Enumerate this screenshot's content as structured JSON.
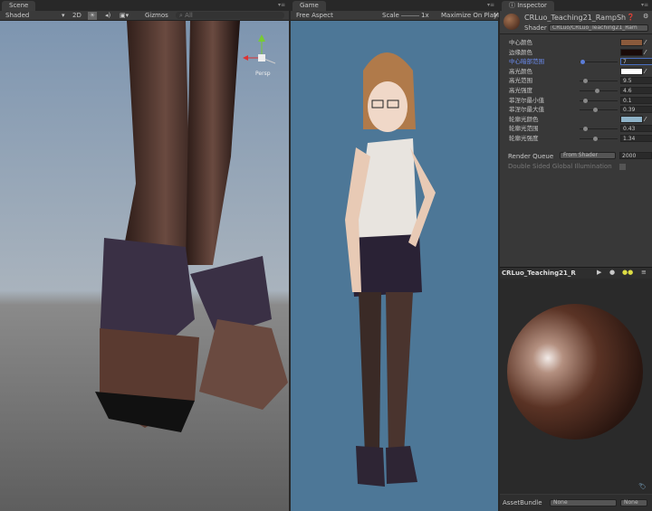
{
  "scene": {
    "tab": "Scene",
    "shading": "Shaded",
    "mode_2d": "2D",
    "gizmos": "Gizmos",
    "search_placeholder": "All",
    "persp": "Persp"
  },
  "game": {
    "tab": "Game",
    "aspect": "Free Aspect",
    "scale_label": "Scale",
    "scale_value": "1x",
    "maximize": "Maximize On Play",
    "more": "M"
  },
  "inspector": {
    "tab": "Inspector",
    "material_name": "CRLuo_Teaching21_RampSh",
    "shader_label": "Shader",
    "shader_value": "CRLuo/CRLuo_Teaching21_Ram",
    "properties": [
      {
        "label": "中心颜色",
        "type": "color",
        "color": "#8a5a3c"
      },
      {
        "label": "边缘颜色",
        "type": "color",
        "color": "#1a0a08"
      },
      {
        "label": "中心暗部范围",
        "type": "slider",
        "value": "7",
        "fraction": 0.02,
        "active": true
      },
      {
        "label": "高光颜色",
        "type": "color",
        "color": "#ffffff"
      },
      {
        "label": "高光范围",
        "type": "slider",
        "value": "9.5",
        "fraction": 0.1
      },
      {
        "label": "高光强度",
        "type": "slider",
        "value": "4.6",
        "fraction": 0.45
      },
      {
        "label": "菲涅尔最小值",
        "type": "slider",
        "value": "0.1",
        "fraction": 0.1
      },
      {
        "label": "菲涅尔最大值",
        "type": "slider",
        "value": "0.39",
        "fraction": 0.39
      },
      {
        "label": "轮廓光颜色",
        "type": "color",
        "color": "#8fb3c8"
      },
      {
        "label": "轮廓光范围",
        "type": "slider",
        "value": "0.43",
        "fraction": 0.1
      },
      {
        "label": "轮廓光强度",
        "type": "slider",
        "value": "1.34",
        "fraction": 0.4
      }
    ],
    "render_queue_label": "Render Queue",
    "render_queue_mode": "From Shader",
    "render_queue_value": "2000",
    "gi_label": "Double Sided Global Illumination",
    "preview_title": "CRLuo_Teaching21_R",
    "assetbundle_label": "AssetBundle",
    "assetbundle_name": "None",
    "assetbundle_variant": "None"
  }
}
